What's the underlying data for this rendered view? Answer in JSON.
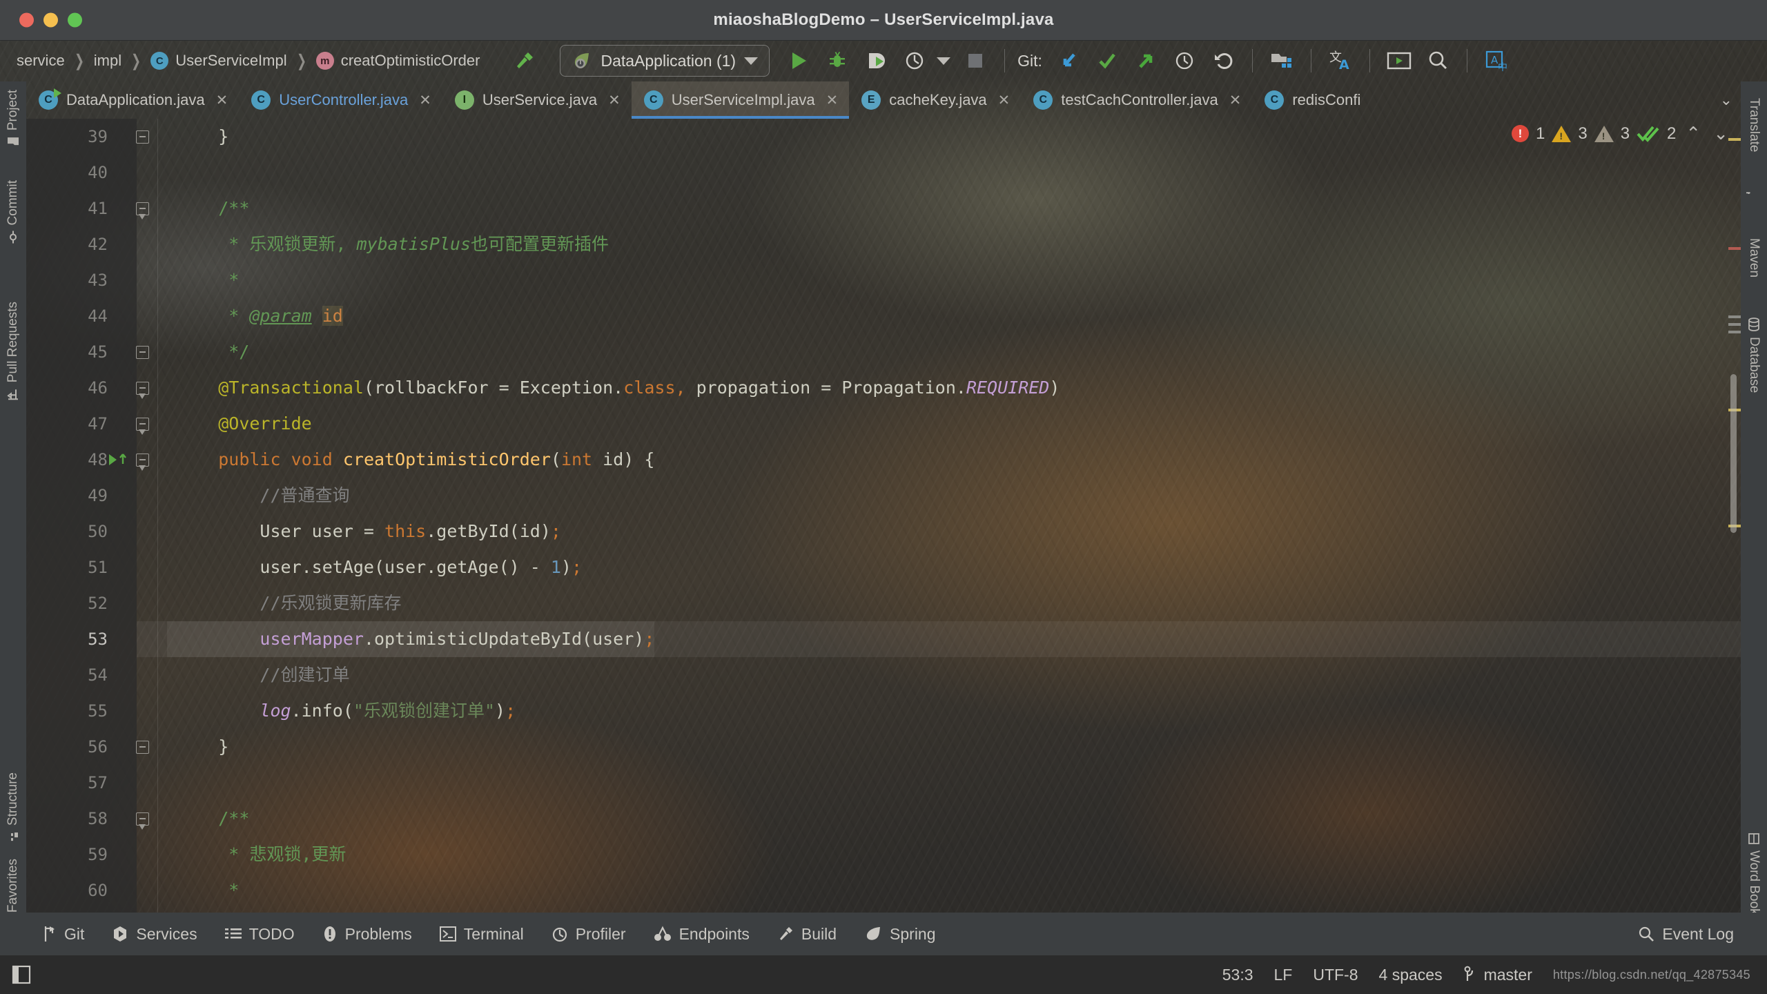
{
  "window": {
    "title": "miaoshaBlogDemo – UserServiceImpl.java",
    "traffic": {
      "close": "close-window",
      "minimize": "minimize-window",
      "maximize": "maximize-window"
    }
  },
  "navbar": {
    "breadcrumbs": [
      {
        "label": "service",
        "icon": null
      },
      {
        "label": "impl",
        "icon": null
      },
      {
        "label": "UserServiceImpl",
        "icon": "C",
        "icon_kind": "class"
      },
      {
        "label": "creatOptimisticOrder",
        "icon": "m",
        "icon_kind": "method"
      }
    ],
    "separator": "›",
    "run_config": {
      "label": "DataApplication (1)",
      "icon": "spring-leaf-icon"
    },
    "actions": [
      "run-icon",
      "debug-icon",
      "run-coverage-icon",
      "profiler-icon",
      "stop-icon"
    ],
    "git_label": "Git:",
    "git_actions": [
      "update-project-icon",
      "commit-icon",
      "push-icon",
      "history-icon",
      "rollback-icon"
    ],
    "right_actions": [
      "project-structure-icon",
      "translate-icon",
      "presentation-icon",
      "search-everywhere-icon",
      "translate-ocr-icon"
    ]
  },
  "left_stripe": [
    {
      "label": "Project",
      "icon": "folder-icon"
    },
    {
      "label": "Commit",
      "icon": "commit-icon"
    },
    {
      "label": "Pull Requests",
      "icon": "pull-request-icon"
    },
    {
      "label": "Structure",
      "icon": "structure-icon"
    },
    {
      "label": "Favorites",
      "icon": "star-icon"
    }
  ],
  "right_stripe": [
    {
      "label": "Translate",
      "icon": "translate-icon"
    },
    {
      "label": "Maven",
      "icon": "maven-icon"
    },
    {
      "label": "Database",
      "icon": "database-icon"
    },
    {
      "label": "Word Book",
      "icon": "book-icon"
    }
  ],
  "tabs": [
    {
      "label": "DataApplication.java",
      "icon": "C",
      "kind": "spring",
      "active": false,
      "modified": false,
      "color": "default"
    },
    {
      "label": "UserController.java",
      "icon": "C",
      "kind": "class",
      "active": false,
      "modified": false,
      "color": "blue"
    },
    {
      "label": "UserService.java",
      "icon": "I",
      "kind": "iface",
      "active": false,
      "modified": false,
      "color": "default"
    },
    {
      "label": "UserServiceImpl.java",
      "icon": "C",
      "kind": "class",
      "active": true,
      "modified": false,
      "color": "default"
    },
    {
      "label": "cacheKey.java",
      "icon": "E",
      "kind": "enum",
      "active": false,
      "modified": false,
      "color": "default"
    },
    {
      "label": "testCachController.java",
      "icon": "C",
      "kind": "class",
      "active": false,
      "modified": false,
      "color": "default"
    },
    {
      "label": "redisConfi",
      "icon": "C",
      "kind": "class",
      "active": false,
      "modified": false,
      "color": "default"
    }
  ],
  "tabs_overflow_icon": "chevron-down-icon",
  "inspections": {
    "errors": "1",
    "warnings": "3",
    "weak_warnings": "3",
    "ok": "2",
    "prev_icon": "chevron-up-icon",
    "next_icon": "chevron-down-icon"
  },
  "editor": {
    "first_line": 39,
    "caret_line": 53,
    "lines": [
      {
        "num": 39,
        "fold": "end",
        "runmark": false,
        "tokens": [
          {
            "t": "    ",
            "c": "c-txt"
          },
          {
            "t": "}",
            "c": "c-txt"
          }
        ]
      },
      {
        "num": 40,
        "fold": "none",
        "runmark": false,
        "tokens": []
      },
      {
        "num": 41,
        "fold": "start",
        "runmark": false,
        "tokens": [
          {
            "t": "    ",
            "c": "c-txt"
          },
          {
            "t": "/**",
            "c": "c-doc"
          }
        ]
      },
      {
        "num": 42,
        "fold": "line",
        "runmark": false,
        "tokens": [
          {
            "t": "     * ",
            "c": "c-doc"
          },
          {
            "t": "乐观锁更新, ",
            "c": "c-doc"
          },
          {
            "t": "mybatisPlus",
            "c": "c-doc c-italic"
          },
          {
            "t": "也可配置更新插件",
            "c": "c-doc"
          }
        ]
      },
      {
        "num": 43,
        "fold": "line",
        "runmark": false,
        "tokens": [
          {
            "t": "     *",
            "c": "c-doc"
          }
        ]
      },
      {
        "num": 44,
        "fold": "line",
        "runmark": false,
        "tokens": [
          {
            "t": "     * ",
            "c": "c-doc"
          },
          {
            "t": "@param",
            "c": "c-doctag"
          },
          {
            "t": " ",
            "c": "c-doc"
          },
          {
            "t": "id",
            "c": "c-docparm"
          }
        ]
      },
      {
        "num": 45,
        "fold": "end",
        "runmark": false,
        "tokens": [
          {
            "t": "     */",
            "c": "c-doc"
          }
        ]
      },
      {
        "num": 46,
        "fold": "start",
        "runmark": false,
        "tokens": [
          {
            "t": "    ",
            "c": "c-txt"
          },
          {
            "t": "@Transactional",
            "c": "c-ann"
          },
          {
            "t": "(rollbackFor = Exception.",
            "c": "c-txt"
          },
          {
            "t": "class",
            "c": "c-kw"
          },
          {
            "t": ", ",
            "c": "c-kw"
          },
          {
            "t": "propagation = Propagation.",
            "c": "c-txt"
          },
          {
            "t": "REQUIRED",
            "c": "c-const"
          },
          {
            "t": ")",
            "c": "c-txt"
          }
        ]
      },
      {
        "num": 47,
        "fold": "start",
        "runmark": false,
        "tokens": [
          {
            "t": "    ",
            "c": "c-txt"
          },
          {
            "t": "@Override",
            "c": "c-ann"
          }
        ]
      },
      {
        "num": 48,
        "fold": "start",
        "runmark": true,
        "tokens": [
          {
            "t": "    ",
            "c": "c-txt"
          },
          {
            "t": "public void ",
            "c": "c-kw"
          },
          {
            "t": "creatOptimisticOrder",
            "c": "c-method"
          },
          {
            "t": "(",
            "c": "c-txt"
          },
          {
            "t": "int ",
            "c": "c-kw"
          },
          {
            "t": "id",
            "c": "c-txt"
          },
          {
            "t": ") {",
            "c": "c-txt"
          }
        ]
      },
      {
        "num": 49,
        "fold": "line",
        "runmark": false,
        "tokens": [
          {
            "t": "        ",
            "c": "c-txt"
          },
          {
            "t": "//普通查询",
            "c": "c-cmt"
          }
        ]
      },
      {
        "num": 50,
        "fold": "line",
        "runmark": false,
        "tokens": [
          {
            "t": "        User user = ",
            "c": "c-txt"
          },
          {
            "t": "this",
            "c": "c-kw"
          },
          {
            "t": ".getById(id)",
            "c": "c-txt"
          },
          {
            "t": ";",
            "c": "c-semi"
          }
        ]
      },
      {
        "num": 51,
        "fold": "line",
        "runmark": false,
        "tokens": [
          {
            "t": "        user.setAge(user.getAge() - ",
            "c": "c-txt"
          },
          {
            "t": "1",
            "c": "c-num"
          },
          {
            "t": ")",
            "c": "c-txt"
          },
          {
            "t": ";",
            "c": "c-semi"
          }
        ]
      },
      {
        "num": 52,
        "fold": "line",
        "runmark": false,
        "tokens": [
          {
            "t": "        ",
            "c": "c-txt"
          },
          {
            "t": "//乐观锁更新库存",
            "c": "c-cmt"
          }
        ]
      },
      {
        "num": 53,
        "fold": "line",
        "runmark": false,
        "highlight": true,
        "tokens": [
          {
            "t": "        ",
            "c": "c-txt"
          },
          {
            "t": "userMapper",
            "c": "c-field"
          },
          {
            "t": ".optimisticUpdateById(user)",
            "c": "c-txt"
          },
          {
            "t": ";",
            "c": "c-semi"
          }
        ]
      },
      {
        "num": 54,
        "fold": "line",
        "runmark": false,
        "tokens": [
          {
            "t": "        ",
            "c": "c-txt"
          },
          {
            "t": "//创建订单",
            "c": "c-cmt"
          }
        ]
      },
      {
        "num": 55,
        "fold": "line",
        "runmark": false,
        "tokens": [
          {
            "t": "        ",
            "c": "c-txt"
          },
          {
            "t": "log",
            "c": "c-static"
          },
          {
            "t": ".info(",
            "c": "c-txt"
          },
          {
            "t": "\"乐观锁创建订单\"",
            "c": "c-str"
          },
          {
            "t": ")",
            "c": "c-txt"
          },
          {
            "t": ";",
            "c": "c-semi"
          }
        ]
      },
      {
        "num": 56,
        "fold": "end",
        "runmark": false,
        "tokens": [
          {
            "t": "    ",
            "c": "c-txt"
          },
          {
            "t": "}",
            "c": "c-txt"
          }
        ]
      },
      {
        "num": 57,
        "fold": "none",
        "runmark": false,
        "tokens": []
      },
      {
        "num": 58,
        "fold": "start",
        "runmark": false,
        "tokens": [
          {
            "t": "    ",
            "c": "c-txt"
          },
          {
            "t": "/**",
            "c": "c-doc"
          }
        ]
      },
      {
        "num": 59,
        "fold": "line",
        "runmark": false,
        "tokens": [
          {
            "t": "     * ",
            "c": "c-doc"
          },
          {
            "t": "悲观锁,更新",
            "c": "c-doc"
          }
        ]
      },
      {
        "num": 60,
        "fold": "line",
        "runmark": false,
        "tokens": [
          {
            "t": "     *",
            "c": "c-doc"
          }
        ]
      }
    ]
  },
  "bottom_tools": [
    {
      "label": "Git",
      "icon": "git-branch-icon"
    },
    {
      "label": "Services",
      "icon": "services-icon"
    },
    {
      "label": "TODO",
      "icon": "todo-list-icon"
    },
    {
      "label": "Problems",
      "icon": "problems-icon"
    },
    {
      "label": "Terminal",
      "icon": "terminal-icon"
    },
    {
      "label": "Profiler",
      "icon": "profiler-icon"
    },
    {
      "label": "Endpoints",
      "icon": "endpoints-icon"
    },
    {
      "label": "Build",
      "icon": "build-hammer-icon"
    },
    {
      "label": "Spring",
      "icon": "spring-leaf-icon"
    }
  ],
  "event_log": {
    "label": "Event Log",
    "icon": "search-icon"
  },
  "statusbar": {
    "layout_icon": "layout-toggle-icon",
    "caret_position": "53:3",
    "line_separator": "LF",
    "encoding": "UTF-8",
    "indent": "4 spaces",
    "branch": "master",
    "branch_icon": "git-branch-icon",
    "watermark": "https://blog.csdn.net/qq_42875345"
  },
  "colors": {
    "accent_blue": "#4a88c7",
    "error_red": "#e0483c",
    "warning_yellow": "#d9a520",
    "ok_green": "#62b34b",
    "keyword_orange": "#cc7832",
    "string_green": "#6a8759",
    "doc_green": "#629755",
    "method_yellow": "#ffc66d"
  }
}
